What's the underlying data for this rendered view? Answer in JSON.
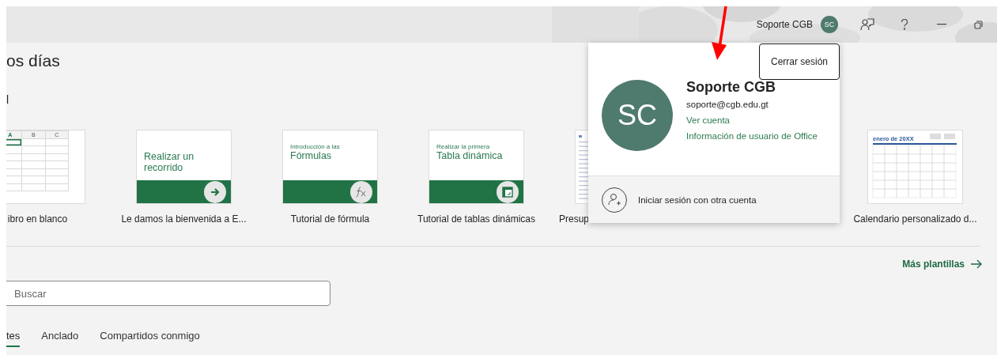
{
  "title_bar": {
    "user_name": "Soporte CGB",
    "avatar_initials": "SC"
  },
  "greeting": "os días",
  "section_heading": "l",
  "templates": [
    {
      "kind": "blank",
      "label": "ibro en blanco",
      "columns": [
        "A",
        "B",
        "C"
      ]
    },
    {
      "kind": "tour",
      "title": "Realizar un recorrido",
      "label": "Le damos la bienvenida a E..."
    },
    {
      "kind": "formula",
      "subtitle": "Introducción a las",
      "title": "Fórmulas",
      "label": "Tutorial de fórmula"
    },
    {
      "kind": "pivot",
      "subtitle": "Realizar la primera",
      "title": "Tabla dinámica",
      "label": "Tutorial de tablas dinámicas"
    },
    {
      "kind": "budget",
      "label": "Presup"
    },
    {
      "kind": "calendar",
      "heading": "enero de 20XX",
      "label": "Calendario personalizado d..."
    }
  ],
  "more_templates": "Más plantillas",
  "search": {
    "placeholder": "Buscar"
  },
  "tabs": [
    {
      "label": "tes",
      "selected": true
    },
    {
      "label": "Anclado",
      "selected": false
    },
    {
      "label": "Compartidos conmigo",
      "selected": false
    }
  ],
  "account_popup": {
    "sign_out": "Cerrar sesión",
    "initials": "SC",
    "name": "Soporte CGB",
    "email": "soporte@cgb.edu.gt",
    "links": [
      "Ver cuenta",
      "Información de usuario de Office"
    ],
    "other_account": "Iniciar sesión con otra cuenta"
  }
}
